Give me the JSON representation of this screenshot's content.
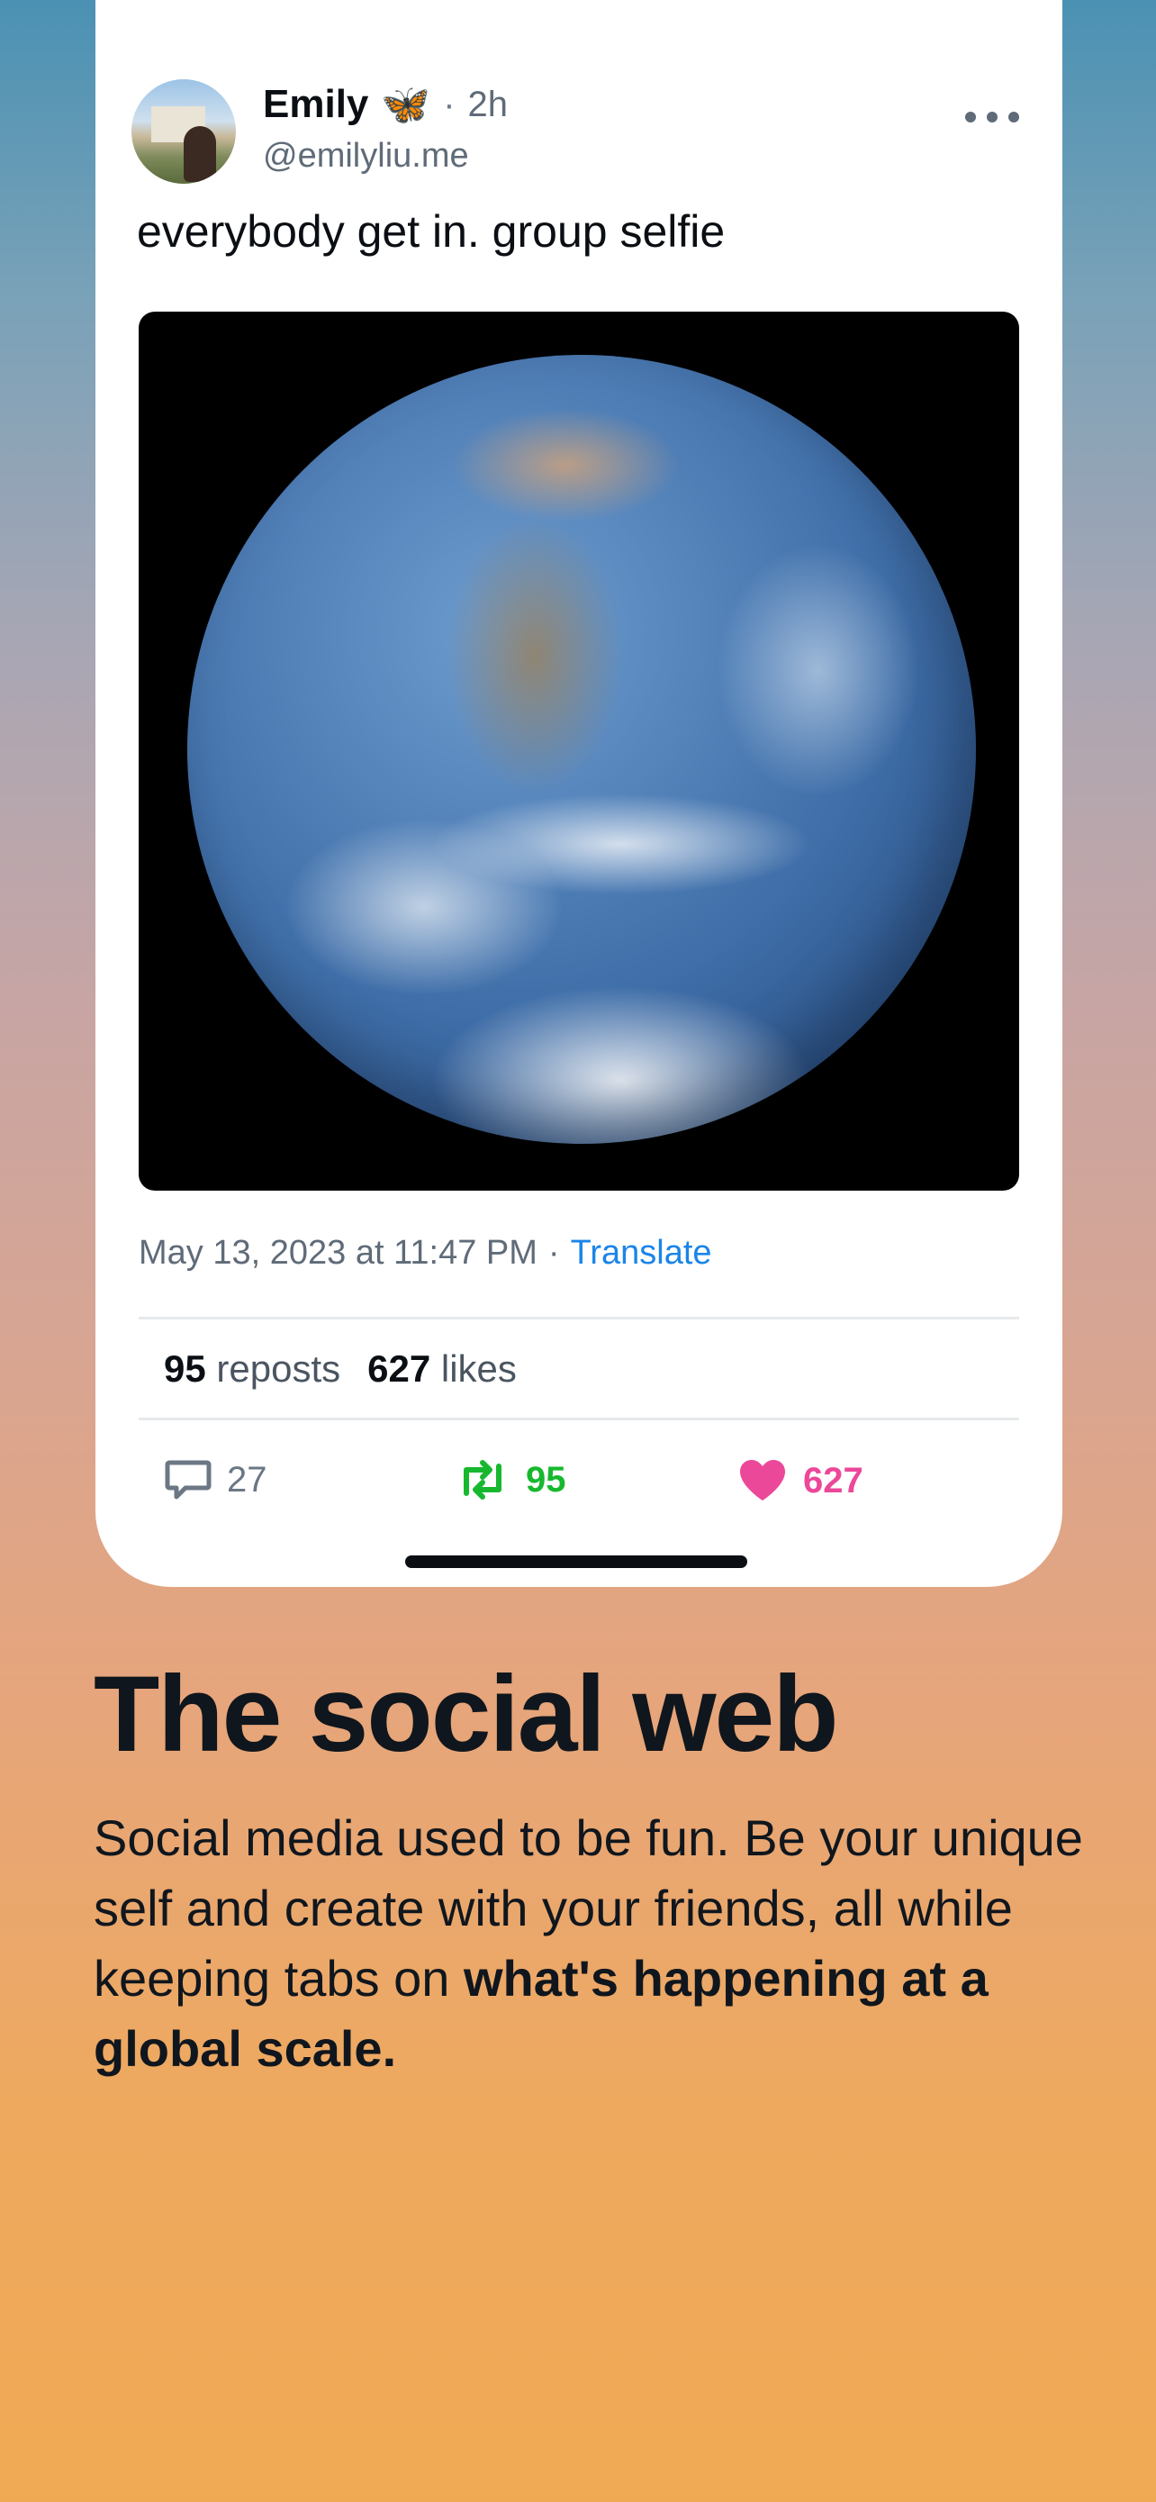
{
  "post": {
    "author_name": "Emily",
    "name_emoji": "🦋",
    "separator": "·",
    "age": "2h",
    "handle": "@emilyliu.me",
    "text": "everybody get in. group selfie",
    "image_alt": "",
    "timestamp": "May 13, 2023 at 11:47 PM",
    "meta_separator": "·",
    "translate_label": "Translate",
    "stats": {
      "reposts_count": "95",
      "reposts_label": "reposts",
      "likes_count": "627",
      "likes_label": "likes"
    },
    "actions": {
      "reply_count": "27",
      "repost_count": "95",
      "like_count": "627"
    }
  },
  "promo": {
    "headline": "The social web",
    "body_plain": "Social media used to be fun. Be your unique self and create with your friends, all while keeping tabs on",
    "body_bold": "what's happening at a global scale."
  },
  "colors": {
    "accent_link": "#1a85e8",
    "repost_green": "#17b82e",
    "like_pink": "#ec4899",
    "gradient_top": "#4b91b3",
    "gradient_bottom": "#f0a953"
  },
  "icons": [
    "reply-icon",
    "repost-icon",
    "heart-icon",
    "more-icon",
    "butterfly-emoji"
  ]
}
